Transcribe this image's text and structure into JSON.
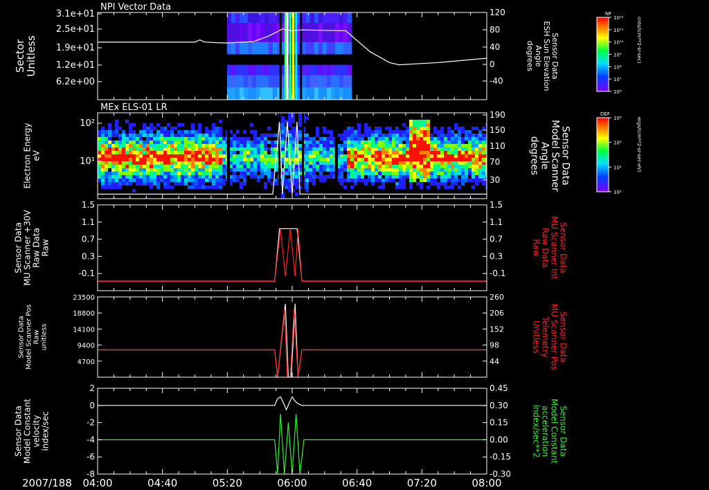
{
  "date_label": "2007/188",
  "x_ticks": [
    "04:00",
    "04:40",
    "05:20",
    "06:00",
    "06:40",
    "07:20",
    "08:00"
  ],
  "x_range_hours": [
    4,
    8
  ],
  "colors": {
    "white": "#ffffff",
    "red": "#ff2020",
    "green": "#33ee33",
    "background": "#000000"
  },
  "chart_data": [
    {
      "type": "heatmap",
      "title": "NPI Vector Data",
      "ylabel_lines": [
        "Sector",
        "Unitless"
      ],
      "left_ticks": [
        "3.1e+01",
        "2.5e+01",
        "1.9e+01",
        "1.2e+01",
        "6.2e+00"
      ],
      "right_ticks": [
        "120",
        "80",
        "40",
        "0",
        "-40"
      ],
      "right_range": [
        -80,
        120
      ],
      "right_label_lines": [
        "Sensor Data",
        "ESH Sun Elevation",
        "Angle",
        "degrees"
      ],
      "colorbar": {
        "label": "NF",
        "ticks": [
          "10¹²",
          "10¹¹",
          "10¹⁰",
          "10⁹",
          "10⁸",
          "10⁷",
          "10⁶"
        ],
        "unit": "cnts/(cm**2-sr-sec)"
      },
      "coverage_hours": [
        5.33,
        6.58
      ],
      "line": {
        "x": [
          4.0,
          4.5,
          5.0,
          5.05,
          5.1,
          5.3,
          5.6,
          5.75,
          5.9,
          6.0,
          6.1,
          6.55,
          6.8,
          7.0,
          7.1,
          7.5,
          8.0
        ],
        "y": [
          52,
          52,
          52,
          57,
          52,
          50,
          53,
          65,
          82,
          78,
          80,
          78,
          30,
          5,
          0,
          5,
          15
        ]
      }
    },
    {
      "type": "heatmap",
      "title": "MEx ELS-01 LR",
      "ylabel_lines": [
        "Electron Energy",
        "eV"
      ],
      "left_ticks": [
        "10²",
        "10¹"
      ],
      "right_ticks": [
        "190",
        "150",
        "110",
        "70",
        "30"
      ],
      "right_range": [
        0,
        190
      ],
      "right_label_lines": [
        "Sensor Data",
        "Model Scanner",
        "Angle",
        "degrees"
      ],
      "colorbar": {
        "label": "DEF",
        "ticks": [
          "10⁴",
          "10³",
          "10²",
          "10¹"
        ],
        "unit": "ergs/(cm**2-sr-sec-eV)"
      },
      "line": {
        "x": [
          4.0,
          5.8,
          5.87,
          5.9,
          5.95,
          6.0,
          6.05,
          6.08,
          6.1,
          8.0
        ],
        "y": [
          10,
          10,
          170,
          10,
          170,
          10,
          170,
          10,
          10,
          10
        ]
      }
    },
    {
      "type": "line",
      "ylabel_lines": [
        "Sensor Data",
        "MU Scanner +30V",
        "Raw Data",
        "Raw"
      ],
      "ylim": [
        -0.3,
        1.5
      ],
      "left_ticks": [
        "1.5",
        "1.1",
        "0.7",
        "0.3",
        "-0.1"
      ],
      "right_ticks": [
        "1.5",
        "1.1",
        "0.7",
        "0.3",
        "-0.1"
      ],
      "right_label_lines": [
        "Sensor Data",
        "MU Scanner Int",
        "Raw Data",
        "Raw"
      ],
      "series": [
        {
          "color": "#ffffff",
          "x": [
            4.0,
            5.82,
            5.87,
            6.05,
            6.1,
            8.0
          ],
          "y": [
            -0.1,
            -0.1,
            1.0,
            1.0,
            -0.1,
            -0.1
          ]
        },
        {
          "color": "#ff2020",
          "x": [
            4.0,
            5.82,
            5.88,
            5.93,
            5.98,
            6.03,
            6.06,
            6.1,
            8.0
          ],
          "y": [
            -0.1,
            -0.1,
            1.0,
            0.0,
            1.0,
            0.0,
            1.0,
            -0.1,
            -0.1
          ]
        }
      ]
    },
    {
      "type": "line",
      "ylabel_lines": [
        "Sensor Data",
        "Model Scanner Pos",
        "Raw",
        "unitless"
      ],
      "ylim": [
        0,
        23500
      ],
      "left_ticks": [
        "23500",
        "18800",
        "14100",
        "9400",
        "4700"
      ],
      "right_ticks": [
        "260",
        "206",
        "152",
        "98",
        "44"
      ],
      "right_range": [
        0,
        260
      ],
      "right_label_lines": [
        "Sensor Data",
        "MU Scanner Pos",
        "Telemetry",
        "Unitless"
      ],
      "series": [
        {
          "color": "#ffffff",
          "x": [
            4.0,
            5.82,
            5.85,
            5.93,
            5.96,
            5.99,
            6.03,
            6.06,
            6.1,
            8.0
          ],
          "y": [
            8000,
            8000,
            0,
            21500,
            0,
            0,
            21500,
            0,
            8000,
            8000
          ]
        },
        {
          "color": "#ff2020",
          "x": [
            4.0,
            5.82,
            5.85,
            5.92,
            5.95,
            5.98,
            6.02,
            6.06,
            6.1,
            8.0
          ],
          "y": [
            8000,
            8000,
            0,
            20000,
            0,
            0,
            20000,
            0,
            8000,
            8000
          ]
        }
      ]
    },
    {
      "type": "line",
      "ylabel_lines": [
        "Sensor Data",
        "Model Constant",
        "velocity",
        "index/sec"
      ],
      "ylim": [
        -8,
        2
      ],
      "left_ticks": [
        "2",
        "0",
        "-2",
        "-4",
        "-6",
        "-8"
      ],
      "right_ticks": [
        "0.45",
        "0.30",
        "0.15",
        "0.00",
        "-0.15",
        "-0.30"
      ],
      "right_label_lines": [
        "Sensor Data",
        "Model Constant",
        "acceleration",
        "index/sec**2"
      ],
      "series": [
        {
          "color": "#ffffff",
          "x": [
            4.0,
            5.82,
            5.85,
            5.88,
            5.91,
            5.94,
            5.97,
            6.0,
            6.03,
            6.06,
            6.1,
            8.0
          ],
          "y": [
            0,
            0,
            0.8,
            1.0,
            0.3,
            -0.5,
            0.3,
            1.0,
            0.5,
            0.2,
            0,
            0
          ]
        },
        {
          "color": "#33ee33",
          "x": [
            4.0,
            5.82,
            5.85,
            5.88,
            5.92,
            5.96,
            6.0,
            6.04,
            6.08,
            6.12,
            8.0
          ],
          "y": [
            -4,
            -4,
            -8,
            -1,
            -8,
            -2,
            -8,
            -1,
            -8,
            -4,
            -4
          ]
        }
      ]
    }
  ]
}
